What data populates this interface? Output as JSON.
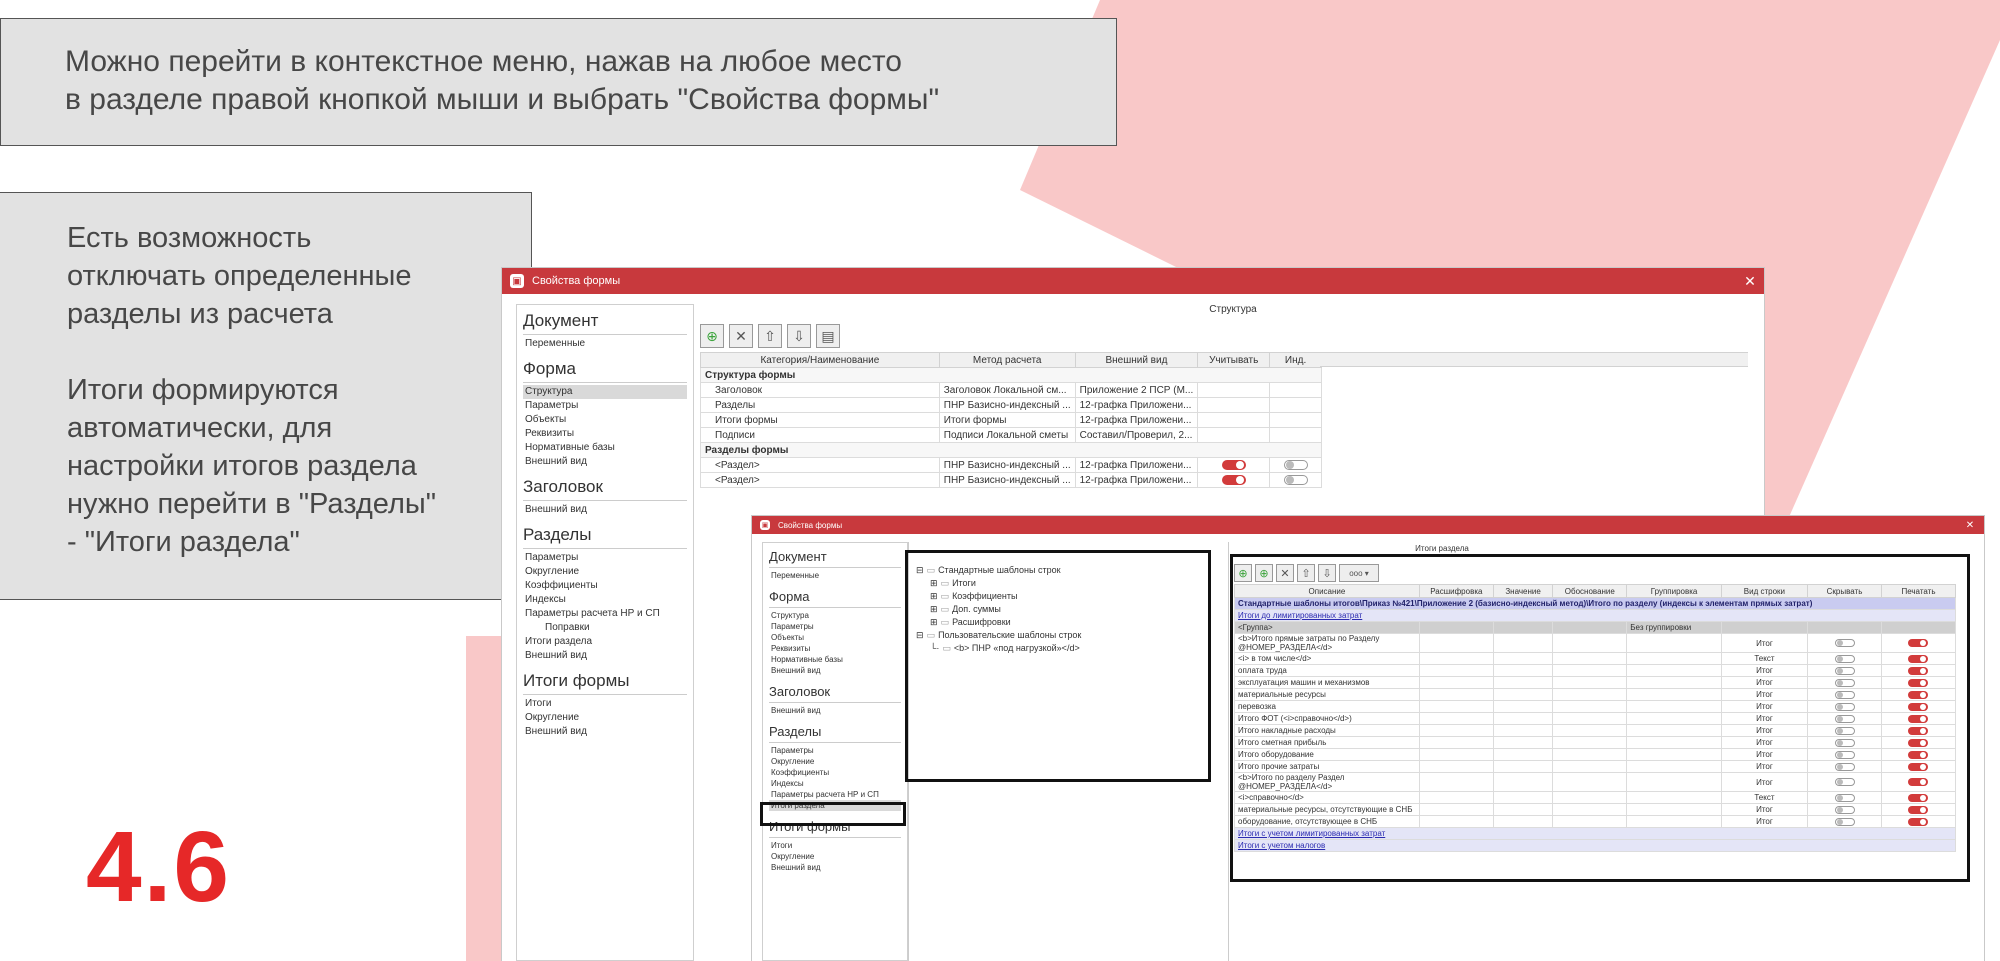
{
  "callouts": {
    "top": "Можно перейти в контекстное меню, нажав на любое место\nв разделе правой кнопкой мыши и выбрать \"Свойства формы\"",
    "left_1": "Есть возможность\nотключать определенные\nразделы из расчета",
    "left_2": "Итоги формируются\nавтоматически, для\nнастройки итогов раздела\nнужно перейти в \"Разделы\"\n- \"Итоги раздела\""
  },
  "slide_number": "4.6",
  "colors": {
    "accent_red": "#e62828",
    "titlebar": "#c8393d",
    "decor": "#f9c8c8"
  },
  "window1": {
    "title": "Свойства формы",
    "panel_title": "Структура",
    "nav": [
      {
        "group": "Документ",
        "items": [
          "Переменные"
        ]
      },
      {
        "group": "Форма",
        "items": [
          "Структура",
          "Параметры",
          "Объекты",
          "Реквизиты",
          "Нормативные базы",
          "Внешний вид"
        ],
        "selected": "Структура"
      },
      {
        "group": "Заголовок",
        "items": [
          "Внешний вид"
        ]
      },
      {
        "group": "Разделы",
        "items": [
          "Параметры",
          "Округление",
          "Коэффициенты",
          "Индексы",
          "Параметры расчета НР и СП",
          "Поправки",
          "Итоги раздела",
          "Внешний вид"
        ]
      },
      {
        "group": "Итоги формы",
        "items": [
          "Итоги",
          "Округление",
          "Внешний вид"
        ]
      }
    ],
    "columns": [
      "Категория/Наименование",
      "Метод расчета",
      "Внешний вид",
      "Учитывать",
      "Инд."
    ],
    "groups": [
      {
        "label": "Структура формы",
        "rows": [
          {
            "name": "Заголовок",
            "method": "Заголовок Локальной см...",
            "view": "Приложение 2 ПСР (М...",
            "use": null,
            "ind": null
          },
          {
            "name": "Разделы",
            "method": "ПНР Базисно-индексный ...",
            "view": "12-графка Приложени...",
            "use": null,
            "ind": null
          },
          {
            "name": "Итоги формы",
            "method": "Итоги формы",
            "view": "12-графка Приложени...",
            "use": null,
            "ind": null
          },
          {
            "name": "Подписи",
            "method": "Подписи Локальной сметы",
            "view": "Составил/Проверил, 2...",
            "use": null,
            "ind": null
          }
        ]
      },
      {
        "label": "Разделы формы",
        "rows": [
          {
            "name": "<Раздел>",
            "method": "ПНР Базисно-индексный ...",
            "view": "12-графка Приложени...",
            "use": "on",
            "ind": "off"
          },
          {
            "name": "<Раздел>",
            "method": "ПНР Базисно-индексный ...",
            "view": "12-графка Приложени...",
            "use": "on",
            "ind": "off"
          }
        ]
      }
    ]
  },
  "window2": {
    "title": "Свойства формы",
    "panel_title": "Итоги раздела",
    "nav": [
      {
        "group": "Документ",
        "items": [
          "Переменные"
        ]
      },
      {
        "group": "Форма",
        "items": [
          "Структура",
          "Параметры",
          "Объекты",
          "Реквизиты",
          "Нормативные базы",
          "Внешний вид"
        ]
      },
      {
        "group": "Заголовок",
        "items": [
          "Внешний вид"
        ]
      },
      {
        "group": "Разделы",
        "items": [
          "Параметры",
          "Округление",
          "Коэффициенты",
          "Индексы",
          "Параметры расчета НР и СП",
          "Итоги раздела"
        ],
        "selected": "Итоги раздела"
      },
      {
        "group": "Итоги формы",
        "items": [
          "Итоги",
          "Округление",
          "Внешний вид"
        ]
      }
    ],
    "tree": [
      {
        "label": "Стандартные шаблоны строк",
        "level": 0,
        "toggle": "⊟"
      },
      {
        "label": "Итоги",
        "level": 1,
        "toggle": "⊞"
      },
      {
        "label": "Коэффициенты",
        "level": 1,
        "toggle": "⊞"
      },
      {
        "label": "Доп. суммы",
        "level": 1,
        "toggle": "⊞"
      },
      {
        "label": "Расшифровки",
        "level": 1,
        "toggle": "⊞"
      },
      {
        "label": "Пользовательские шаблоны строк",
        "level": 0,
        "toggle": "⊟"
      },
      {
        "label": "<b>   ПНР «под нагрузкой»</d>",
        "level": 1,
        "toggle": ""
      }
    ],
    "dropdown_value": "ooo",
    "columns": [
      "Описание",
      "Расшифровка",
      "Значение",
      "Обоснование",
      "Группировка",
      "Вид строки",
      "Скрывать",
      "Печатать"
    ],
    "band_title": "Стандартные шаблоны итогов\\Приказ №421\\Приложение 2 (базисно-индексный метод)\\Итого по разделу (индексы к элементам прямых затрат)",
    "rows": [
      {
        "desc": "Итоги до лимитированных затрат",
        "kind": "link",
        "group": "",
        "type": "",
        "hide": null,
        "print": null
      },
      {
        "desc": "<Группа>",
        "kind": "grey",
        "group": "Без группировки",
        "type": "",
        "hide": null,
        "print": null
      },
      {
        "desc": "<b>Итого прямые затраты по Разделу @НОМЕР_РАЗДЕЛА</d>",
        "kind": "",
        "group": "",
        "type": "Итог",
        "hide": "off",
        "print": "on"
      },
      {
        "desc": "<i>   в том числе</d>",
        "kind": "",
        "group": "",
        "type": "Текст",
        "hide": "off",
        "print": "on"
      },
      {
        "desc": "оплата труда",
        "kind": "",
        "group": "",
        "type": "Итог",
        "hide": "off",
        "print": "on"
      },
      {
        "desc": "эксплуатация машин и механизмов",
        "kind": "",
        "group": "",
        "type": "Итог",
        "hide": "off",
        "print": "on"
      },
      {
        "desc": "материальные ресурсы",
        "kind": "",
        "group": "",
        "type": "Итог",
        "hide": "off",
        "print": "on"
      },
      {
        "desc": "перевозка",
        "kind": "",
        "group": "",
        "type": "Итог",
        "hide": "off",
        "print": "on"
      },
      {
        "desc": "Итого ФОТ (<i>справочно</d>)",
        "kind": "",
        "group": "",
        "type": "Итог",
        "hide": "off",
        "print": "on"
      },
      {
        "desc": "Итого накладные расходы",
        "kind": "",
        "group": "",
        "type": "Итог",
        "hide": "off",
        "print": "on"
      },
      {
        "desc": "Итого сметная прибыль",
        "kind": "",
        "group": "",
        "type": "Итог",
        "hide": "off",
        "print": "on"
      },
      {
        "desc": "Итого оборудование",
        "kind": "",
        "group": "",
        "type": "Итог",
        "hide": "off",
        "print": "on"
      },
      {
        "desc": "Итого прочие затраты",
        "kind": "",
        "group": "",
        "type": "Итог",
        "hide": "off",
        "print": "on"
      },
      {
        "desc": "<b>Итого по разделу Раздел @НОМЕР_РАЗДЕЛА</d>",
        "kind": "",
        "group": "",
        "type": "Итог",
        "hide": "off",
        "print": "on"
      },
      {
        "desc": "<i>справочно</d>",
        "kind": "",
        "group": "",
        "type": "Текст",
        "hide": "off",
        "print": "on"
      },
      {
        "desc": "материальные ресурсы, отсутствующие в СНБ",
        "kind": "",
        "group": "",
        "type": "Итог",
        "hide": "off",
        "print": "on"
      },
      {
        "desc": "оборудование, отсутствующее в СНБ",
        "kind": "",
        "group": "",
        "type": "Итог",
        "hide": "off",
        "print": "on"
      },
      {
        "desc": "Итоги с учетом лимитированных затрат",
        "kind": "link",
        "group": "",
        "type": "",
        "hide": null,
        "print": null
      },
      {
        "desc": "Итоги с учетом налогов",
        "kind": "link",
        "group": "",
        "type": "",
        "hide": null,
        "print": null
      }
    ]
  }
}
